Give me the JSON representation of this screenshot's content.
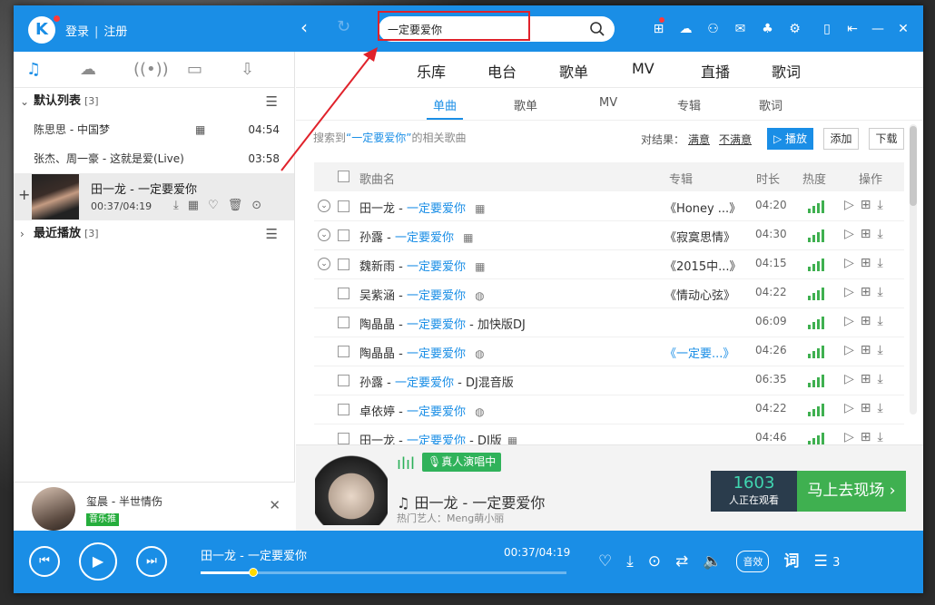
{
  "titlebar": {
    "logo": "K",
    "login": "登录",
    "register": "注册",
    "search_value": "一定要爱你"
  },
  "sidebar": {
    "default_list": {
      "label": "默认列表",
      "count": "[3]"
    },
    "songs": [
      {
        "title": "陈思思 - 中国梦",
        "duration": "04:54"
      },
      {
        "title": "张杰、周一豪 - 这就是爱(Live)",
        "duration": "03:58"
      }
    ],
    "now_playing": {
      "title": "田一龙 - 一定要爱你",
      "time": "00:37/04:19"
    },
    "recent": {
      "label": "最近播放",
      "count": "[3]"
    },
    "mini": {
      "name": "玺晨 - 半世情伤",
      "badge": "音乐推"
    }
  },
  "main": {
    "tabs": [
      "乐库",
      "电台",
      "歌单",
      "MV",
      "直播",
      "歌词"
    ],
    "subtabs": [
      "单曲",
      "歌单",
      "MV",
      "专辑",
      "歌词"
    ],
    "result": {
      "prefix": "搜索到",
      "keyword": "“一定要爱你”",
      "suffix": "的相关歌曲"
    },
    "feedback": {
      "label": "对结果：",
      "good": "满意",
      "bad": "不满意"
    },
    "buttons": {
      "play": "播放",
      "add": "添加",
      "download": "下载"
    },
    "columns": {
      "name": "歌曲名",
      "album": "专辑",
      "duration": "时长",
      "heat": "热度",
      "ops": "操作"
    },
    "rows": [
      {
        "artist": "田一龙",
        "song": "一定要爱你",
        "suffix": "",
        "album": "《Honey ...》",
        "album_link": false,
        "duration": "04:20"
      },
      {
        "artist": "孙露",
        "song": "一定要爱你",
        "suffix": "",
        "album": "《寂寞思情》",
        "album_link": false,
        "duration": "04:30"
      },
      {
        "artist": "魏新雨",
        "song": "一定要爱你",
        "suffix": "",
        "album": "《2015中...》",
        "album_link": false,
        "duration": "04:15"
      },
      {
        "artist": "吴紫涵",
        "song": "一定要爱你",
        "suffix": "",
        "album": "《情动心弦》",
        "album_link": false,
        "duration": "04:22"
      },
      {
        "artist": "陶晶晶",
        "song": "一定要爱你",
        "suffix": "- 加快版DJ",
        "album": "",
        "album_link": false,
        "duration": "06:09"
      },
      {
        "artist": "陶晶晶",
        "song": "一定要爱你",
        "suffix": "",
        "album": "《一定要...》",
        "album_link": true,
        "duration": "04:26"
      },
      {
        "artist": "孙露",
        "song": "一定要爱你",
        "suffix": "- DJ混音版",
        "album": "",
        "album_link": false,
        "duration": "06:35"
      },
      {
        "artist": "卓依婷",
        "song": "一定要爱你",
        "suffix": "",
        "album": "",
        "album_link": false,
        "duration": "04:22"
      },
      {
        "artist": "田一龙",
        "song": "一定要爱你",
        "suffix": "- DJ版",
        "album": "",
        "album_link": false,
        "duration": "04:46"
      }
    ],
    "banner": {
      "live_label": "真人演唱中",
      "song": "田一龙 - 一定要爱你",
      "artist": "热门艺人：Meng萌小丽",
      "viewers": "1603",
      "viewers_label": "人正在观看",
      "go_live": "马上去现场 ›"
    }
  },
  "player": {
    "title": "田一龙 - 一定要爱你",
    "time": "00:37/04:19",
    "progress": 0.143,
    "effect": "音效",
    "lyric": "词",
    "queue_count": "3"
  },
  "colors": {
    "primary": "#1a8ee6",
    "green": "#3fb050",
    "red": "#e0222b"
  }
}
